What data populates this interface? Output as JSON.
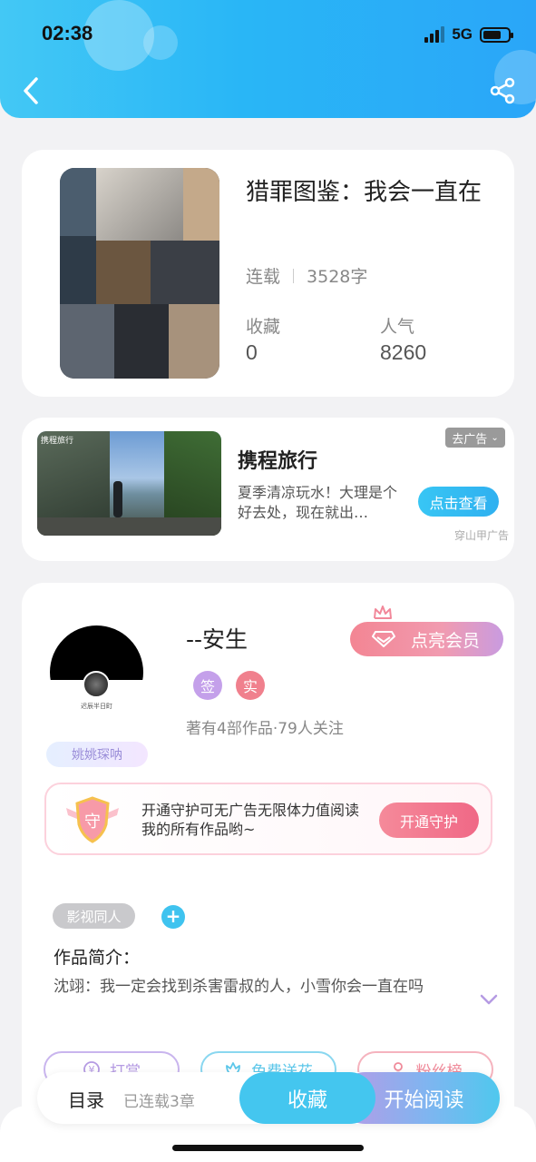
{
  "status_bar": {
    "time": "02:38",
    "network": "5G"
  },
  "header": {
    "back_icon": "chevron-left-icon",
    "share_icon": "share-icon",
    "accent": "#29b6f6"
  },
  "book": {
    "title": "猎罪图鉴：我会一直在",
    "status": "连载",
    "word_count": "3528字",
    "favorites_label": "收藏",
    "favorites_value": "0",
    "popularity_label": "人气",
    "popularity_value": "8260"
  },
  "ad": {
    "title": "携程旅行",
    "description": "夏季清凉玩水！大理是个好去处，现在就出…",
    "tag": "去广告",
    "button": "点击查看",
    "source": "穿山甲广告",
    "image_logo": "携程旅行"
  },
  "author": {
    "name": "--安生",
    "badges": [
      "签",
      "实"
    ],
    "stats": "著有4部作品·79人关注",
    "vip_button": "点亮会员",
    "fan_tag": "姚姚琛呐",
    "avatar_caption": "迟辰半日町"
  },
  "guard": {
    "text": "开通守护可无广告无限体力值阅读我的所有作品哟~",
    "button": "开通守护",
    "icon_char": "守"
  },
  "work": {
    "genre_tag": "影视同人",
    "intro_label": "作品简介：",
    "intro_text": "沈翊：我一定会找到杀害雷叔的人，小雪你会一直在吗"
  },
  "actions": [
    {
      "label": "打赏",
      "icon": "yen-icon",
      "color": "#b59be3"
    },
    {
      "label": "免费送花",
      "icon": "flower-icon",
      "color": "#5cc7ea"
    },
    {
      "label": "粉丝榜",
      "icon": "user-icon",
      "color": "#f08a9a"
    }
  ],
  "bottom_bar": {
    "toc": "目录",
    "chapters": "已连载3章",
    "favorite": "收藏",
    "read": "开始阅读"
  }
}
